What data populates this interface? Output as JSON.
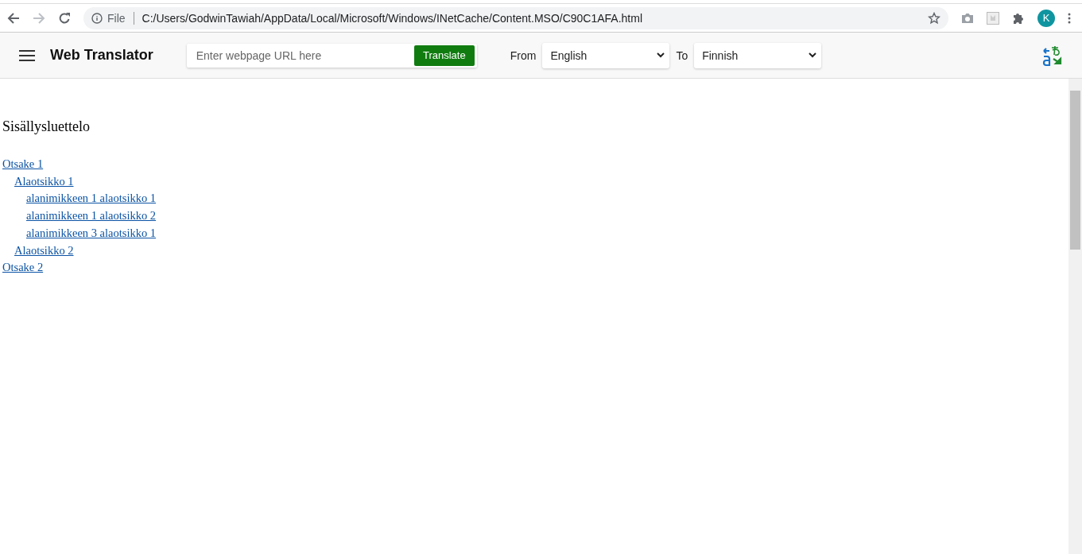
{
  "browser": {
    "forward_disabled": true,
    "address_scheme": "File",
    "address": "C:/Users/GodwinTawiah/AppData/Local/Microsoft/Windows/INetCache/Content.MSO/C90C1AFA.html",
    "avatar": "K"
  },
  "app_bar": {
    "title": "Web Translator",
    "url_field": {
      "placeholder": "Enter webpage URL here"
    },
    "translate_button": "Translate",
    "from_label": "From",
    "from_value": "English",
    "to_label": "To",
    "to_value": "Finnish"
  },
  "page": {
    "heading": "Sisällysluettelo",
    "toc": [
      {
        "label": "Otsake 1",
        "children": [
          {
            "label": "Alaotsikko 1",
            "children": [
              {
                "label": "alanimikkeen 1 alaotsikko 1"
              },
              {
                "label": "alanimikkeen 1 alaotsikko 2"
              },
              {
                "label": "alanimikkeen 3 alaotsikko 1"
              }
            ]
          },
          {
            "label": "Alaotsikko 2"
          }
        ]
      },
      {
        "label": "Otsake 2"
      }
    ]
  }
}
